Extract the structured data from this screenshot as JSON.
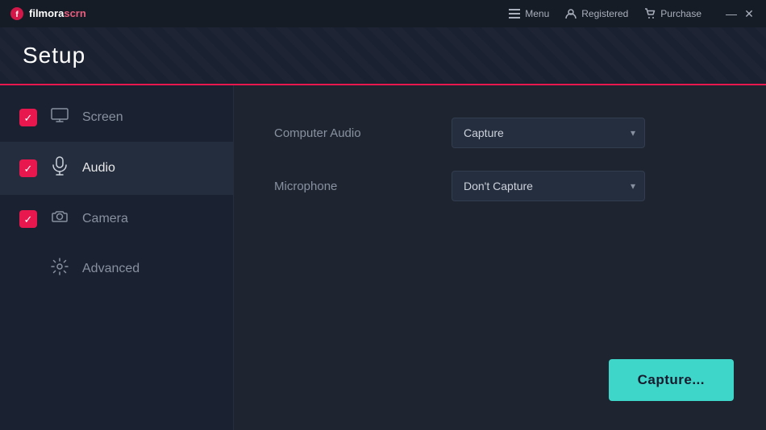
{
  "app": {
    "logo_text": "filmora",
    "logo_scrn": "scrn",
    "title": "Setup"
  },
  "titlebar": {
    "menu_label": "Menu",
    "registered_label": "Registered",
    "purchase_label": "Purchase",
    "minimize_icon": "—",
    "close_icon": "✕"
  },
  "sidebar": {
    "items": [
      {
        "id": "screen",
        "label": "Screen",
        "has_checkbox": true,
        "checked": true,
        "active": false
      },
      {
        "id": "audio",
        "label": "Audio",
        "has_checkbox": true,
        "checked": true,
        "active": true
      },
      {
        "id": "camera",
        "label": "Camera",
        "has_checkbox": true,
        "checked": true,
        "active": false
      },
      {
        "id": "advanced",
        "label": "Advanced",
        "has_checkbox": false,
        "checked": false,
        "active": false
      }
    ]
  },
  "content": {
    "computer_audio_label": "Computer Audio",
    "microphone_label": "Microphone",
    "computer_audio_options": [
      "Capture",
      "Don't Capture"
    ],
    "computer_audio_value": "Capture",
    "microphone_options": [
      "Capture",
      "Don't Capture"
    ],
    "microphone_value": "Don't Capture",
    "capture_btn_label": "Capture..."
  },
  "colors": {
    "accent_pink": "#e8184e",
    "accent_teal": "#3dd6c8",
    "bg_dark": "#161c26",
    "bg_sidebar": "#1a2130",
    "bg_content": "#1e2530"
  }
}
